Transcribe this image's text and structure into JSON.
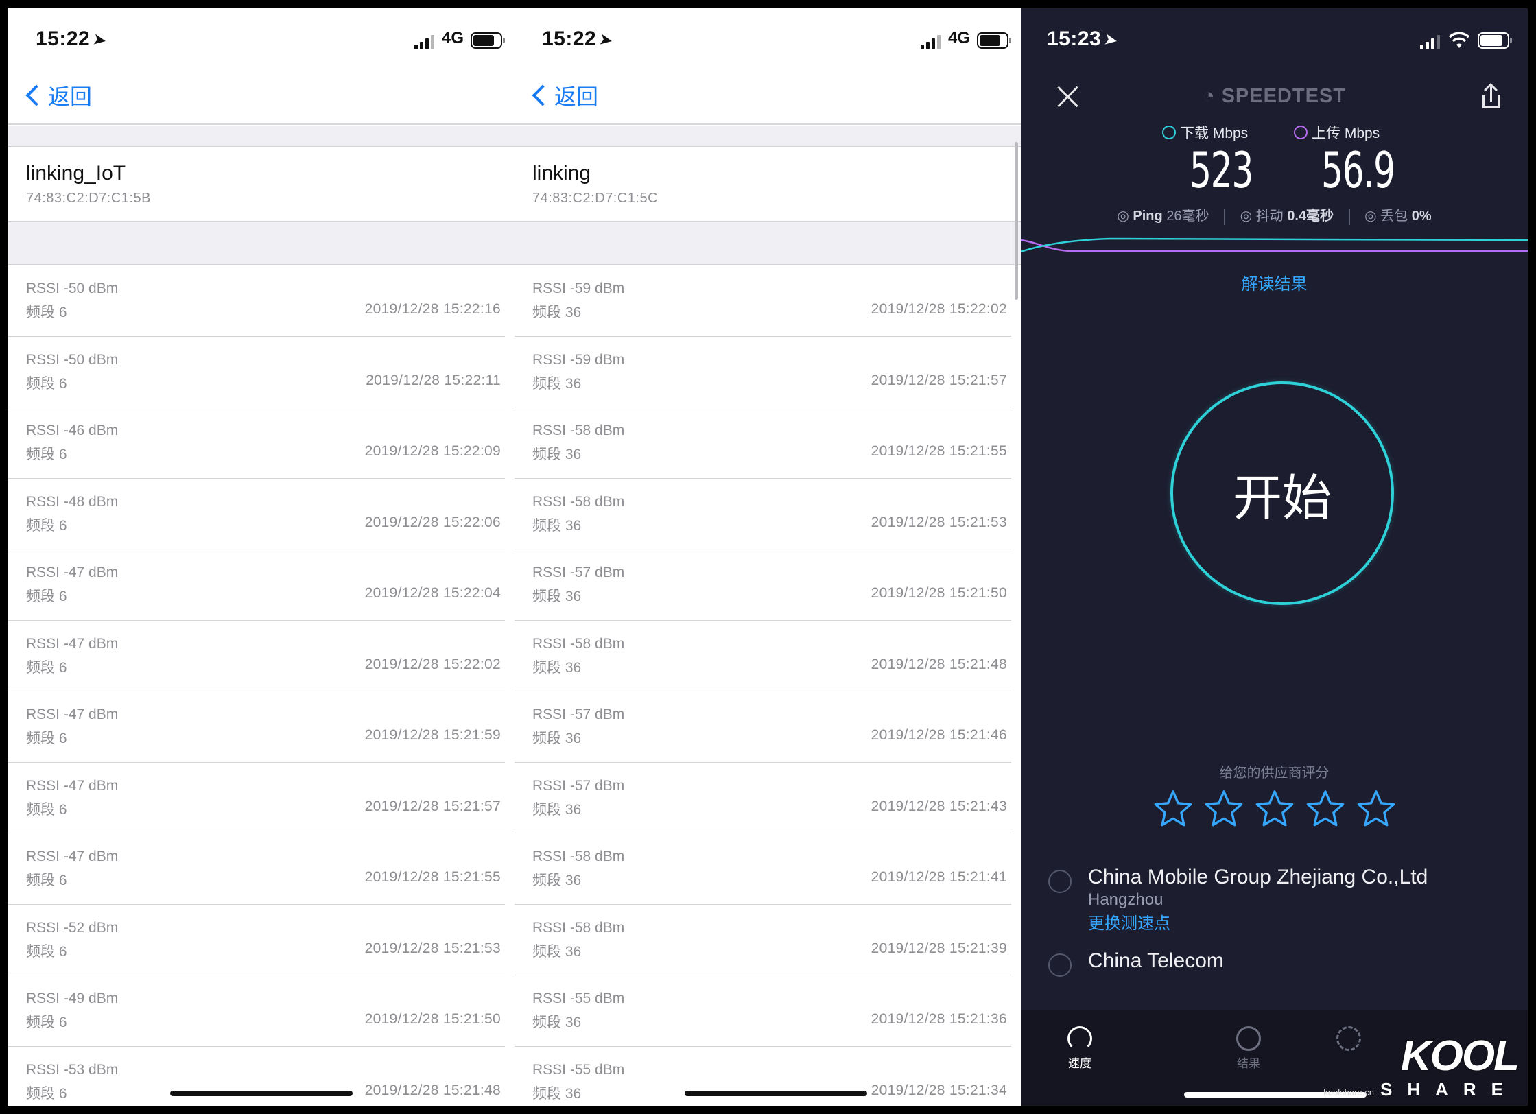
{
  "left": {
    "time": "15:22",
    "network": "4G",
    "back_label": "返回",
    "ssid": "linking_IoT",
    "mac": "74:83:C2:D7:C1:5B",
    "rows": [
      {
        "rssi": "RSSI -50 dBm",
        "band": "频段 6",
        "ts": "2019/12/28 15:22:16"
      },
      {
        "rssi": "RSSI -50 dBm",
        "band": "频段 6",
        "ts": "2019/12/28 15:22:11"
      },
      {
        "rssi": "RSSI -46 dBm",
        "band": "频段 6",
        "ts": "2019/12/28 15:22:09"
      },
      {
        "rssi": "RSSI -48 dBm",
        "band": "频段 6",
        "ts": "2019/12/28 15:22:06"
      },
      {
        "rssi": "RSSI -47 dBm",
        "band": "频段 6",
        "ts": "2019/12/28 15:22:04"
      },
      {
        "rssi": "RSSI -47 dBm",
        "band": "频段 6",
        "ts": "2019/12/28 15:22:02"
      },
      {
        "rssi": "RSSI -47 dBm",
        "band": "频段 6",
        "ts": "2019/12/28 15:21:59"
      },
      {
        "rssi": "RSSI -47 dBm",
        "band": "频段 6",
        "ts": "2019/12/28 15:21:57"
      },
      {
        "rssi": "RSSI -47 dBm",
        "band": "频段 6",
        "ts": "2019/12/28 15:21:55"
      },
      {
        "rssi": "RSSI -52 dBm",
        "band": "频段 6",
        "ts": "2019/12/28 15:21:53"
      },
      {
        "rssi": "RSSI -49 dBm",
        "band": "频段 6",
        "ts": "2019/12/28 15:21:50"
      },
      {
        "rssi": "RSSI -53 dBm",
        "band": "频段 6",
        "ts": "2019/12/28 15:21:48"
      }
    ]
  },
  "middle": {
    "time": "15:22",
    "network": "4G",
    "back_label": "返回",
    "ssid": "linking",
    "mac": "74:83:C2:D7:C1:5C",
    "rows": [
      {
        "rssi": "RSSI -59 dBm",
        "band": "频段 36",
        "ts": "2019/12/28 15:22:02"
      },
      {
        "rssi": "RSSI -59 dBm",
        "band": "频段 36",
        "ts": "2019/12/28 15:21:57"
      },
      {
        "rssi": "RSSI -58 dBm",
        "band": "频段 36",
        "ts": "2019/12/28 15:21:55"
      },
      {
        "rssi": "RSSI -58 dBm",
        "band": "频段 36",
        "ts": "2019/12/28 15:21:53"
      },
      {
        "rssi": "RSSI -57 dBm",
        "band": "频段 36",
        "ts": "2019/12/28 15:21:50"
      },
      {
        "rssi": "RSSI -58 dBm",
        "band": "频段 36",
        "ts": "2019/12/28 15:21:48"
      },
      {
        "rssi": "RSSI -57 dBm",
        "band": "频段 36",
        "ts": "2019/12/28 15:21:46"
      },
      {
        "rssi": "RSSI -57 dBm",
        "band": "频段 36",
        "ts": "2019/12/28 15:21:43"
      },
      {
        "rssi": "RSSI -58 dBm",
        "band": "频段 36",
        "ts": "2019/12/28 15:21:41"
      },
      {
        "rssi": "RSSI -58 dBm",
        "band": "频段 36",
        "ts": "2019/12/28 15:21:39"
      },
      {
        "rssi": "RSSI -55 dBm",
        "band": "频段 36",
        "ts": "2019/12/28 15:21:36"
      },
      {
        "rssi": "RSSI -55 dBm",
        "band": "频段 36",
        "ts": "2019/12/28 15:21:34"
      }
    ]
  },
  "speedtest": {
    "time": "15:23",
    "title": "SPEEDTEST",
    "download_label": "下载 Mbps",
    "upload_label": "上传 Mbps",
    "download_value": "523",
    "upload_value": "56.9",
    "ping_label": "Ping",
    "ping_value": "26毫秒",
    "jitter_label": "抖动",
    "jitter_value": "0.4毫秒",
    "loss_label": "丢包",
    "loss_value": "0%",
    "interpret_label": "解读结果",
    "go_label": "开始",
    "rate_label": "给您的供应商评分",
    "star_count": 5,
    "provider": "China Mobile Group Zhejiang Co.,Ltd",
    "city": "Hangzhou",
    "change_server": "更换测速点",
    "isp": "China Telecom",
    "tabs": {
      "speed": "速度",
      "results": "结果"
    },
    "colors": {
      "accent_cyan": "#2fd1d8",
      "link_blue": "#35a7ff",
      "upload_purple": "#b56cf0",
      "bg": "#1c1d2e"
    }
  },
  "watermark": {
    "brand": "KOOL",
    "sub": "SHARE",
    "domain": "koolshare.cn"
  }
}
